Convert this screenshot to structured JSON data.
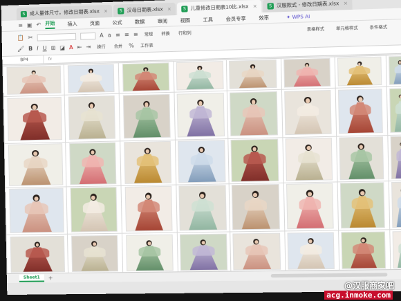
{
  "tabs": [
    {
      "label": "成人量体尺寸，修改日期表.xlsx",
      "active": false
    },
    {
      "label": "汉母日期表.xlsx",
      "active": false
    },
    {
      "label": "儿童修改日期表10比.xlsx",
      "active": true
    },
    {
      "label": "汉服款式 - 修改日期表.xlsx",
      "active": false
    }
  ],
  "menu": {
    "items": [
      "开始",
      "插入",
      "页面",
      "公式",
      "数据",
      "审阅",
      "视图",
      "工具",
      "会员专享",
      "效率"
    ],
    "active": "开始",
    "ai_label": "WPS AI"
  },
  "ribbon": {
    "font_name": "",
    "font_size": "",
    "wrap_label": "换行",
    "merge_label": "合并",
    "normal_label": "常规",
    "convert_label": "转换",
    "rowcol_label": "行和列",
    "worksheet_label": "工作表",
    "cond_format_label": "条件格式",
    "cell_style_label": "单元格样式",
    "table_style_label": "表格样式"
  },
  "formula": {
    "cell_ref": "BP4",
    "fx": "fx"
  },
  "sheet": {
    "name": "Sheet1",
    "add_symbol": "+"
  },
  "watermark": {
    "line1": "@汉服商家吧",
    "line2": "acg.inmoke.com"
  },
  "colors": {
    "accent": "#1f9d55",
    "ai_purple": "#5a4fcf",
    "watermark_red": "#c8102e"
  }
}
